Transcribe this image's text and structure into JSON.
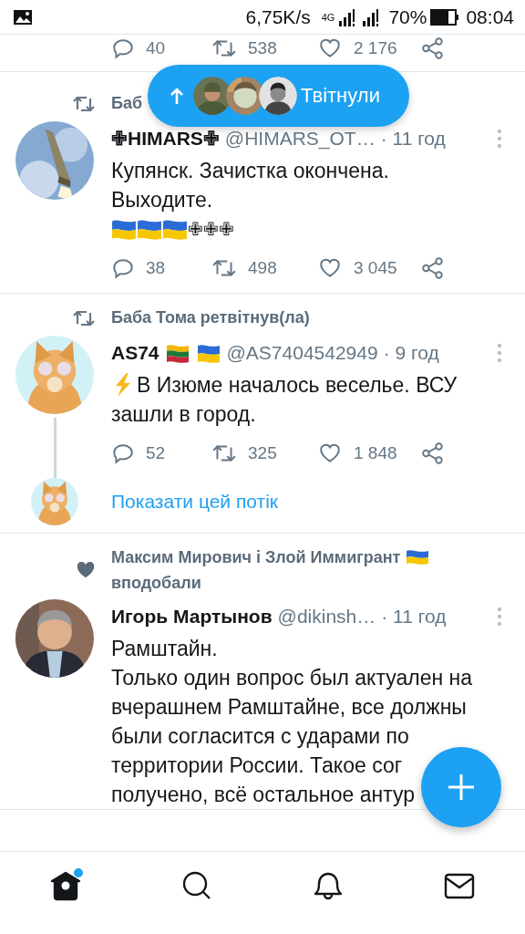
{
  "status_bar": {
    "speed": "6,75K/s",
    "network": "4G",
    "battery": "70%",
    "time": "08:04"
  },
  "new_tweets_pill": {
    "label": "Твітнули"
  },
  "tweets": [
    {
      "kind": "partial",
      "actions": [
        {
          "kind": "reply",
          "count": "40"
        },
        {
          "kind": "retweet",
          "count": "538"
        },
        {
          "kind": "like",
          "count": "2 176"
        },
        {
          "kind": "share"
        }
      ]
    },
    {
      "kind": "tweet",
      "social": {
        "kind": "retweet",
        "lines": [
          "Баб"
        ]
      },
      "name": "✙HIMARS✙",
      "handle": "@HIMARS_OT…",
      "time": "· 11 год",
      "lines": [
        "Купянск. Зачистка окончена.",
        "Выходите."
      ],
      "extra": {
        "flags": [
          {
            "kind": "ua"
          },
          {
            "kind": "ua"
          },
          {
            "kind": "ua"
          }
        ],
        "text": "✙✙✙"
      },
      "actions": [
        {
          "kind": "reply",
          "count": "38"
        },
        {
          "kind": "retweet",
          "count": "498"
        },
        {
          "kind": "like",
          "count": "3 045"
        },
        {
          "kind": "share"
        }
      ]
    },
    {
      "kind": "tweet",
      "social": {
        "kind": "retweet",
        "lines": [
          "Баба Тома ретвітнув(ла)"
        ]
      },
      "name": "AS74",
      "name_flags": [
        {
          "kind": "lt"
        },
        {
          "kind": "ua"
        }
      ],
      "handle": "@AS7404542949",
      "time": "· 9 год",
      "lead_icon": {
        "kind": "lightning"
      },
      "lines": [
        "В Изюме началось веселье. ВСУ",
        "зашли в город."
      ],
      "actions": [
        {
          "kind": "reply",
          "count": "52"
        },
        {
          "kind": "retweet",
          "count": "325"
        },
        {
          "kind": "like",
          "count": "1 848"
        },
        {
          "kind": "share"
        }
      ],
      "thread_link": "Показати цей потік"
    },
    {
      "kind": "tweet",
      "social": {
        "kind": "like",
        "lines": [
          "Максим Мирович і Злой Иммигрант",
          "вподобали"
        ],
        "flag": {
          "kind": "ua"
        }
      },
      "name": "Игорь Мартынов",
      "handle": "@dikinsh…",
      "time": "· 11 год",
      "lines": [
        "Рамштайн.",
        "Только один вопрос был актуален на",
        "вчерашнем Рамштайне, все должны",
        "были согласится с ударами по",
        "территории России. Такое сог",
        "получено, всё остальное антур"
      ]
    }
  ],
  "nav": [
    {
      "kind": "home",
      "selected": true,
      "badge": true
    },
    {
      "kind": "search",
      "selected": false,
      "badge": false
    },
    {
      "kind": "notifications",
      "selected": false,
      "badge": false
    },
    {
      "kind": "messages",
      "selected": false,
      "badge": false
    }
  ]
}
